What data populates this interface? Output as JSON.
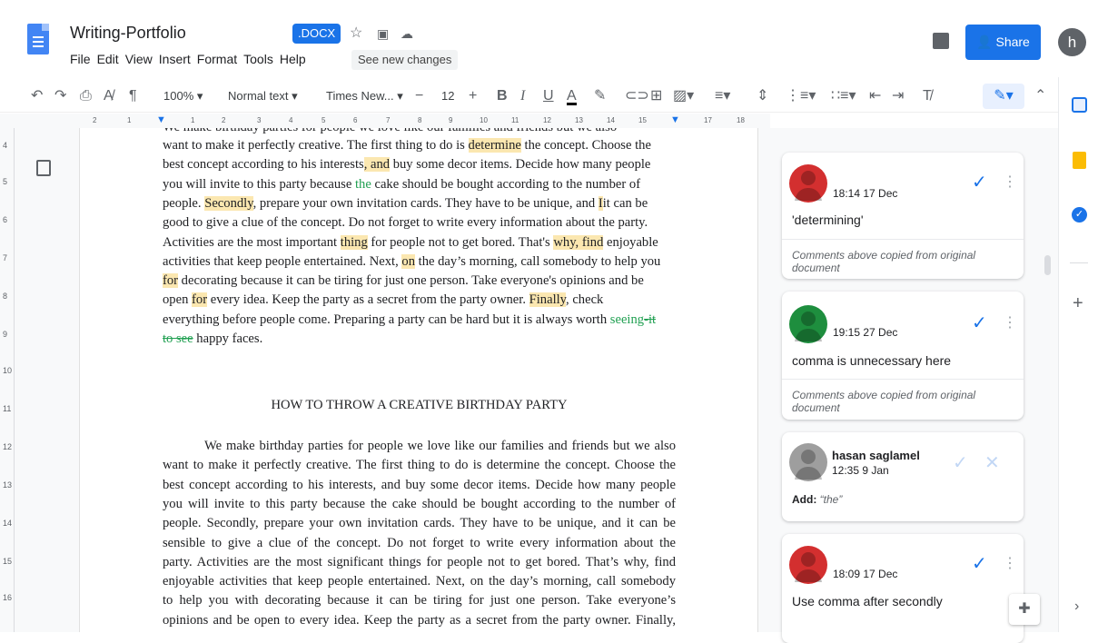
{
  "window": {
    "title": "Writing-Portfolio",
    "badge": ".DOCX",
    "see_changes": "See new changes",
    "share": "Share",
    "account_initial": "h"
  },
  "menu": [
    "File",
    "Edit",
    "View",
    "Insert",
    "Format",
    "Tools",
    "Help"
  ],
  "toolbar": {
    "zoom": "100%",
    "style": "Normal text",
    "font": "Times New...",
    "font_size": "12"
  },
  "ruler": {
    "h_marks": [
      "2",
      "1",
      "1",
      "2",
      "3",
      "4",
      "5",
      "6",
      "7",
      "8",
      "9",
      "10",
      "11",
      "12",
      "13",
      "14",
      "15",
      "16",
      "17",
      "18"
    ],
    "v_marks": [
      "4",
      "5",
      "6",
      "7",
      "8",
      "9",
      "10",
      "11",
      "12",
      "13",
      "14",
      "15",
      "16"
    ]
  },
  "document": {
    "partial_top": "We make birthday parties for people we love like our families and friends but we also",
    "para1": [
      [
        {
          "t": "want to make it perfectly creative. The first thing to do is "
        },
        {
          "t": "determine",
          "s": "hl"
        },
        {
          "t": " the concept. Choose the"
        }
      ],
      [
        {
          "t": "best concept according to his interests"
        },
        {
          "t": ", and",
          "s": "hl"
        },
        {
          "t": " buy some decor items. Decide how many people"
        }
      ],
      [
        {
          "t": "you will invite to this party because "
        },
        {
          "t": "the",
          "s": "green"
        },
        {
          "t": " cake should be bought according to the number of"
        }
      ],
      [
        {
          "t": "people. "
        },
        {
          "t": "Secondly",
          "s": "hl"
        },
        {
          "t": ", prepare your own invitation cards. They have to be unique, and "
        },
        {
          "t": "I",
          "s": "hl"
        },
        {
          "t": "it can be"
        }
      ],
      [
        {
          "t": "good to give a clue of the concept. Do not forget to write every information about the party."
        }
      ],
      [
        {
          "t": "Activities are the most important "
        },
        {
          "t": "thing",
          "s": "hl"
        },
        {
          "t": " for people not to get bored. That's "
        },
        {
          "t": "why, find",
          "s": "hl"
        },
        {
          "t": " enjoyable"
        }
      ],
      [
        {
          "t": "activities that keep people entertained. Next, "
        },
        {
          "t": "on",
          "s": "hl"
        },
        {
          "t": " the day’s morning, call somebody to help you"
        }
      ],
      [
        {
          "t": "for",
          "s": "hl"
        },
        {
          "t": " decorating because it can be tiring for just one person. Take everyone's opinions and be"
        }
      ],
      [
        {
          "t": "open "
        },
        {
          "t": "for",
          "s": "hl"
        },
        {
          "t": " every idea. Keep the party as a secret from the party owner. "
        },
        {
          "t": "Finally",
          "s": "hl"
        },
        {
          "t": ", check"
        }
      ],
      [
        {
          "t": "everything before people come. Preparing a party can be hard but it is always worth "
        },
        {
          "t": "seeing",
          "s": "green"
        },
        {
          "t": "-it",
          "s": "strike"
        }
      ],
      [
        {
          "t": "to see",
          "s": "strike"
        },
        {
          "t": " happy faces."
        }
      ]
    ],
    "heading": "HOW TO THROW A CREATIVE BIRTHDAY PARTY",
    "para2": [
      "We make birthday parties for people we love like our families and friends but we also",
      "want to make it perfectly creative. The first thing to do is determine the concept. Choose the",
      "best concept according to his interests, and buy some decor items. Decide how many people",
      "you will invite to this party because the cake should be bought according to the number of",
      "people. Secondly, prepare your own invitation cards. They have to be unique, and it can be",
      "sensible to give a clue of the concept. Do not forget to write every information about the",
      "party. Activities are the most significant things for people not to get bored. That’s why, find",
      "enjoyable activities that keep people entertained. Next, on the day’s morning, call somebody",
      "to help you with decorating because it can be tiring for just one person. Take everyone’s",
      "opinions and be open to every idea. Keep the party as a secret from the party owner. Finally,"
    ]
  },
  "comments": [
    {
      "time": "18:14 17 Dec",
      "text": "'determining'",
      "note": "Comments above copied from original document",
      "avatar_color": "#d32f2f"
    },
    {
      "time": "19:15 27 Dec",
      "text": "comma is unnecessary here",
      "note": "Comments above copied from original document",
      "avatar_color": "#1e8e3e"
    },
    {
      "name": "hasan saglamel",
      "time": "12:35 9 Jan",
      "add_label": "Add:",
      "add_value": "“the”",
      "avatar_color": "#9e9e9e"
    },
    {
      "time": "18:09 17 Dec",
      "text": "Use comma after secondly",
      "avatar_color": "#d32f2f"
    }
  ]
}
